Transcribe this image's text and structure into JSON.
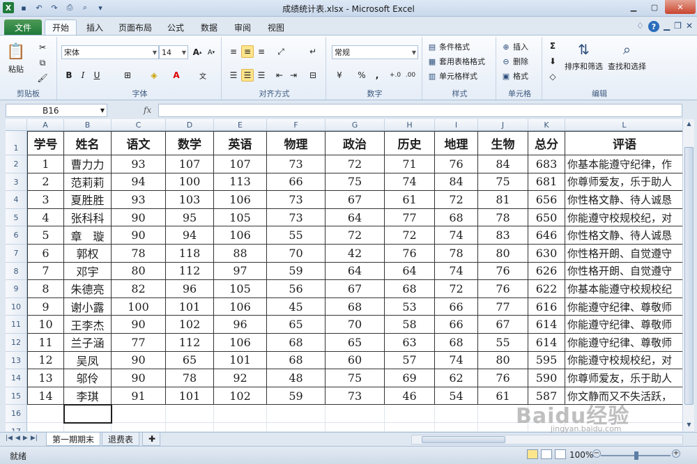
{
  "window": {
    "title": "成绩统计表.xlsx - Microsoft Excel"
  },
  "ribbon_tabs": [
    "文件",
    "开始",
    "插入",
    "页面布局",
    "公式",
    "数据",
    "审阅",
    "视图"
  ],
  "ribbon": {
    "clipboard": {
      "paste": "粘贴",
      "label": "剪贴板"
    },
    "font": {
      "name": "宋体",
      "size": "14",
      "label": "字体"
    },
    "alignment": {
      "label": "对齐方式"
    },
    "number": {
      "format": "常规",
      "label": "数字"
    },
    "styles": {
      "conditional": "条件格式",
      "table": "套用表格格式",
      "cell": "单元格样式",
      "label": "样式"
    },
    "cells": {
      "insert": "插入",
      "delete": "删除",
      "format": "格式",
      "label": "单元格"
    },
    "editing": {
      "sort": "排序和筛选",
      "find": "查找和选择",
      "label": "编辑"
    }
  },
  "formula_bar": {
    "name_box": "B16",
    "fx": "fx",
    "formula": ""
  },
  "columns": [
    "A",
    "B",
    "C",
    "D",
    "E",
    "F",
    "G",
    "H",
    "I",
    "J",
    "K",
    "L"
  ],
  "row_numbers": [
    "1",
    "2",
    "3",
    "4",
    "5",
    "6",
    "7",
    "8",
    "9",
    "10",
    "11",
    "12",
    "13",
    "14",
    "15",
    "16",
    "17"
  ],
  "table": {
    "headers": [
      "学号",
      "姓名",
      "语文",
      "数学",
      "英语",
      "物理",
      "政治",
      "历史",
      "地理",
      "生物",
      "总分",
      "评语"
    ],
    "rows": [
      [
        "1",
        "曹力力",
        "93",
        "107",
        "107",
        "73",
        "72",
        "71",
        "76",
        "84",
        "683",
        "你基本能遵守纪律，作"
      ],
      [
        "2",
        "范莉莉",
        "94",
        "100",
        "113",
        "66",
        "75",
        "74",
        "84",
        "75",
        "681",
        "你尊师爱友，乐于助人"
      ],
      [
        "3",
        "夏胜胜",
        "93",
        "103",
        "106",
        "73",
        "67",
        "61",
        "72",
        "81",
        "656",
        "你性格文静、待人诚恳"
      ],
      [
        "4",
        "张科科",
        "90",
        "95",
        "105",
        "73",
        "64",
        "77",
        "68",
        "78",
        "650",
        "你能遵守校规校纪，对"
      ],
      [
        "5",
        "章　璇",
        "90",
        "94",
        "106",
        "55",
        "72",
        "72",
        "74",
        "83",
        "646",
        "你性格文静、待人诚恳"
      ],
      [
        "6",
        "郭权",
        "78",
        "118",
        "88",
        "70",
        "42",
        "76",
        "78",
        "80",
        "630",
        "你性格开朗、自觉遵守"
      ],
      [
        "7",
        "邓宇",
        "80",
        "112",
        "97",
        "59",
        "64",
        "64",
        "74",
        "76",
        "626",
        "你性格开朗、自觉遵守"
      ],
      [
        "8",
        "朱德亮",
        "82",
        "96",
        "105",
        "56",
        "67",
        "68",
        "72",
        "76",
        "622",
        "你基本能遵守校规校纪"
      ],
      [
        "9",
        "谢小露",
        "100",
        "101",
        "106",
        "45",
        "68",
        "53",
        "66",
        "77",
        "616",
        "你能遵守纪律、尊敬师"
      ],
      [
        "10",
        "王李杰",
        "90",
        "102",
        "96",
        "65",
        "70",
        "58",
        "66",
        "67",
        "614",
        "你能遵守纪律、尊敬师"
      ],
      [
        "11",
        "兰子涵",
        "77",
        "112",
        "106",
        "68",
        "65",
        "63",
        "68",
        "55",
        "614",
        "你能遵守纪律、尊敬师"
      ],
      [
        "12",
        "吴凤",
        "90",
        "65",
        "101",
        "68",
        "60",
        "57",
        "74",
        "80",
        "595",
        "你能遵守校规校纪，对"
      ],
      [
        "13",
        "邬伶",
        "90",
        "78",
        "92",
        "48",
        "75",
        "69",
        "62",
        "76",
        "590",
        "你尊师爱友，乐于助人"
      ],
      [
        "14",
        "李琪",
        "91",
        "101",
        "102",
        "59",
        "73",
        "46",
        "54",
        "61",
        "587",
        "你文静而又不失活跃，"
      ]
    ]
  },
  "sheet_tabs": [
    "第一期期末",
    "退费表"
  ],
  "status": {
    "mode": "就绪",
    "zoom": "100%"
  },
  "watermark": {
    "main": "Baidu经验",
    "sub": "jingyan.baidu.com"
  }
}
